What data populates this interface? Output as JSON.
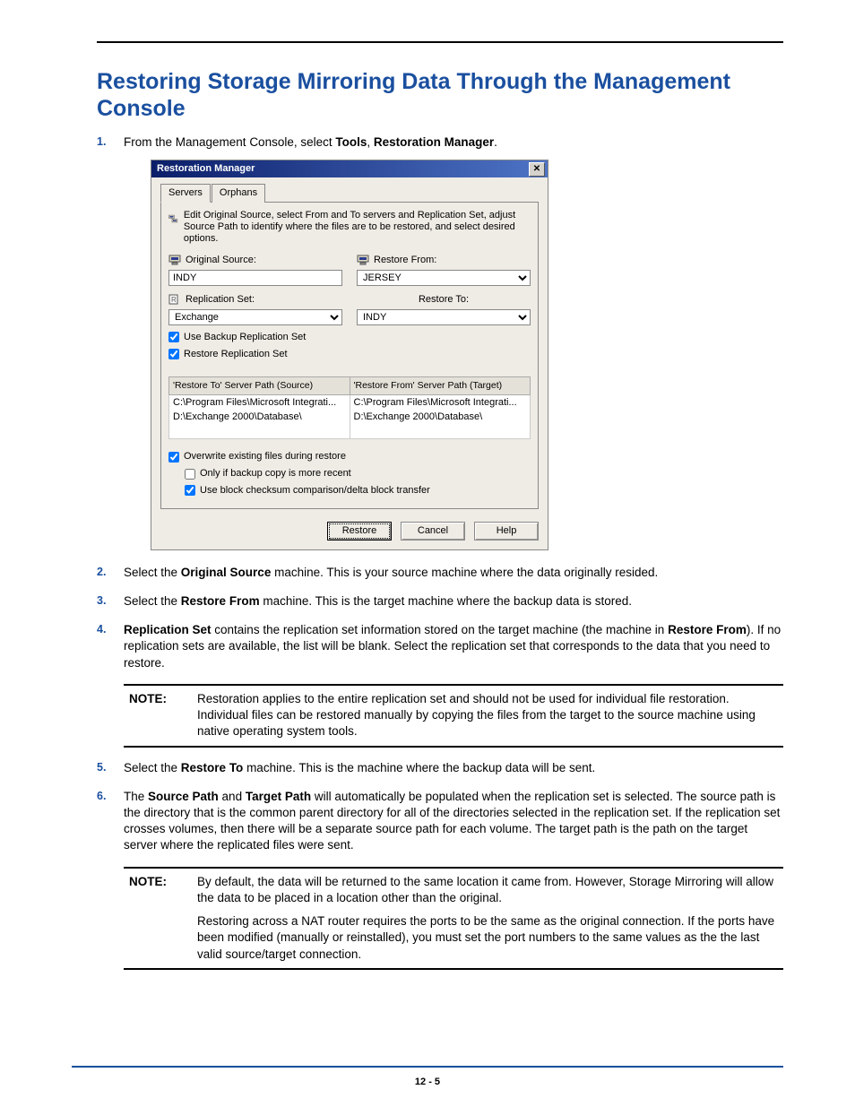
{
  "title": "Restoring Storage Mirroring Data Through the Management Console",
  "step1_a": "From the Management Console, select ",
  "step1_b": "Tools",
  "step1_c": ", ",
  "step1_d": "Restoration Manager",
  "step1_e": ".",
  "dialog": {
    "title": "Restoration Manager",
    "tab_servers": "Servers",
    "tab_orphans": "Orphans",
    "intro": "Edit Original Source, select From and To servers and Replication Set, adjust Source Path to identify where the files are to be restored, and select desired options.",
    "original_source_label": "Original Source:",
    "original_source_value": "INDY",
    "replication_set_label": "Replication Set:",
    "replication_set_value": "Exchange",
    "restore_from_label": "Restore From:",
    "restore_from_value": "JERSEY",
    "restore_to_label": "Restore To:",
    "restore_to_value": "INDY",
    "chk_use_backup": "Use Backup Replication Set",
    "chk_restore_rep": "Restore Replication Set",
    "col_source": "'Restore To' Server Path (Source)",
    "col_target": "'Restore From' Server Path (Target)",
    "rows": [
      {
        "src": "C:\\Program Files\\Microsoft Integrati...",
        "tgt": "C:\\Program Files\\Microsoft Integrati..."
      },
      {
        "src": "D:\\Exchange 2000\\Database\\",
        "tgt": "D:\\Exchange 2000\\Database\\"
      }
    ],
    "chk_overwrite": "Overwrite existing files during restore",
    "chk_recent": "Only if backup copy is more recent",
    "chk_checksum": "Use block checksum comparison/delta block transfer",
    "btn_restore": "Restore",
    "btn_cancel": "Cancel",
    "btn_help": "Help"
  },
  "step2_a": "Select the ",
  "step2_b": "Original Source",
  "step2_c": " machine.  This is your source machine where the data originally resided.",
  "step3_a": "Select the ",
  "step3_b": "Restore From",
  "step3_c": " machine. This is the target machine where the backup data is stored.",
  "step4_a": "Replication Set",
  "step4_b": " contains the replication set information stored on the target machine (the machine in ",
  "step4_c": "Restore From",
  "step4_d": "). If no replication sets are available, the list will be blank. Select the replication set that corresponds to the data that you need to restore.",
  "note1_label": "NOTE:",
  "note1_text": "Restoration applies to the entire replication set and should not be used for individual file restoration. Individual files can be restored manually by copying the files from the target to the source machine using native operating system tools.",
  "step5_a": "Select the ",
  "step5_b": "Restore To",
  "step5_c": " machine.  This is the machine where the backup data will be sent.",
  "step6_a": "The ",
  "step6_b": "Source Path",
  "step6_c": " and ",
  "step6_d": "Target Path",
  "step6_e": " will automatically be populated when the replication set is selected.  The source path is the directory that is the common parent directory for all of the directories selected in the replication set.  If the replication set crosses volumes, then there will be a separate source path for each volume. The target path is the path on the target server where the replicated files were sent.",
  "note2_label": "NOTE:",
  "note2_p1": "By default, the data will be returned to the same location it came from. However, Storage Mirroring will allow the data to be placed in a location other than the original.",
  "note2_p2": "Restoring across a NAT router requires the ports to be the same as the original connection. If the ports have been modified (manually or reinstalled), you must set the port numbers to the same values as the the last valid source/target connection.",
  "pagenum": "12 - 5"
}
